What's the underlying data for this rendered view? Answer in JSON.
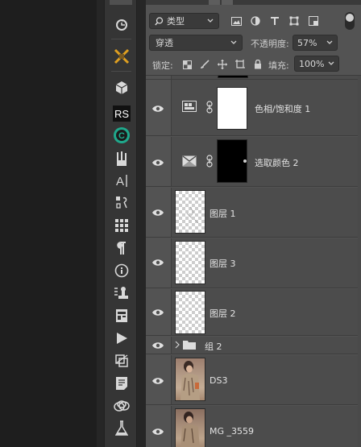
{
  "filter": {
    "kind_label": "类型",
    "filter_icons": [
      "image-filter-icon",
      "adjustment-filter-icon",
      "type-filter-icon",
      "shape-filter-icon",
      "smart-object-filter-icon"
    ]
  },
  "blend": {
    "mode": "穿透",
    "opacity_label": "不透明度:",
    "opacity_value": "57%"
  },
  "lock": {
    "label": "锁定:",
    "icons": [
      "lock-transparent-icon",
      "lock-paint-icon",
      "lock-position-icon",
      "lock-artboard-icon",
      "lock-all-icon"
    ],
    "fill_label": "填充:",
    "fill_value": "100%"
  },
  "layers": [
    {
      "name": "",
      "type": "partial"
    },
    {
      "name": "色相/饱和度 1",
      "type": "adjustment-hue"
    },
    {
      "name": "选取颜色 2",
      "type": "adjustment-selective"
    },
    {
      "name": "图层 1",
      "type": "raster"
    },
    {
      "name": "图层 3",
      "type": "raster"
    },
    {
      "name": "图层 2",
      "type": "raster"
    },
    {
      "name": "组 2",
      "type": "group"
    },
    {
      "name": "DS3",
      "type": "photo"
    },
    {
      "name": "MG _3559",
      "type": "photo"
    }
  ],
  "tool_rail": [
    "history-icon",
    "brush-tools-icon",
    "3d-cube-icon",
    "rs-plugin-icon",
    "coolorus-icon",
    "brush-presets-icon",
    "character-icon",
    "glyphs-icon",
    "swatches-grid-icon",
    "paragraph-icon",
    "info-icon",
    "stamp-icon",
    "navigator-icon",
    "actions-play-icon",
    "properties-icon",
    "notes-icon",
    "libraries-icon",
    "flask-icon"
  ]
}
